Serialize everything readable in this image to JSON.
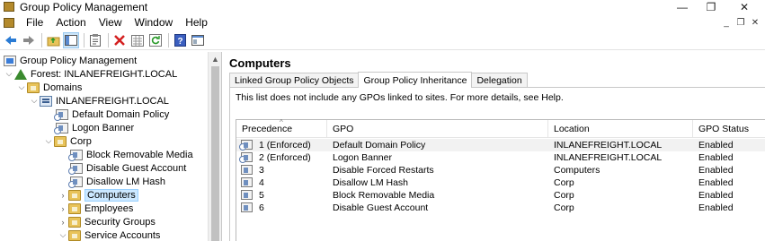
{
  "window": {
    "title": "Group Policy Management",
    "controls": {
      "minimize": "—",
      "maximize": "❐",
      "close": "✕"
    }
  },
  "menu": [
    "File",
    "Action",
    "View",
    "Window",
    "Help"
  ],
  "mdi_controls": {
    "minimize": "_",
    "restore": "❐",
    "close": "✕"
  },
  "toolbar": {
    "icons": [
      "back-arrow-icon",
      "forward-arrow-icon",
      "up-folder-icon",
      "show-tree-icon",
      "properties-icon",
      "delete-icon",
      "export-icon",
      "refresh-icon",
      "help-icon",
      "console-icon"
    ]
  },
  "tree": {
    "items": [
      {
        "label": "Group Policy Management",
        "icon": "gpm",
        "expander": ""
      },
      {
        "label": "Forest: INLANEFREIGHT.LOCAL",
        "icon": "forest",
        "expander": "⌵"
      },
      {
        "label": "Domains",
        "icon": "folder",
        "expander": "⌵"
      },
      {
        "label": "INLANEFREIGHT.LOCAL",
        "icon": "domain",
        "expander": "⌵"
      },
      {
        "label": "Default Domain Policy",
        "icon": "gpo-link",
        "expander": ""
      },
      {
        "label": "Logon Banner",
        "icon": "gpo-link",
        "expander": ""
      },
      {
        "label": "Corp",
        "icon": "folder",
        "expander": "⌵"
      },
      {
        "label": "Block Removable Media",
        "icon": "gpo-link",
        "expander": ""
      },
      {
        "label": "Disable Guest Account",
        "icon": "gpo-link",
        "expander": ""
      },
      {
        "label": "Disallow LM Hash",
        "icon": "gpo-link",
        "expander": ""
      },
      {
        "label": "Computers",
        "icon": "folder",
        "expander": "›",
        "selected": true
      },
      {
        "label": "Employees",
        "icon": "folder",
        "expander": "›"
      },
      {
        "label": "Security Groups",
        "icon": "folder",
        "expander": "›"
      },
      {
        "label": "Service Accounts",
        "icon": "folder",
        "expander": "⌵"
      }
    ]
  },
  "details": {
    "title": "Computers",
    "tabs": [
      "Linked Group Policy Objects",
      "Group Policy Inheritance",
      "Delegation"
    ],
    "active_tab": "Group Policy Inheritance",
    "note": "This list does not include any GPOs linked to sites. For more details, see Help.",
    "columns": [
      "Precedence",
      "GPO",
      "Location",
      "GPO Status"
    ],
    "rows": [
      {
        "precedence": "1 (Enforced)",
        "gpo": "Default Domain Policy",
        "location": "INLANEFREIGHT.LOCAL",
        "status": "Enabled"
      },
      {
        "precedence": "2 (Enforced)",
        "gpo": "Logon Banner",
        "location": "INLANEFREIGHT.LOCAL",
        "status": "Enabled"
      },
      {
        "precedence": "3",
        "gpo": "Disable Forced Restarts",
        "location": "Computers",
        "status": "Enabled"
      },
      {
        "precedence": "4",
        "gpo": "Disallow LM Hash",
        "location": "Corp",
        "status": "Enabled"
      },
      {
        "precedence": "5",
        "gpo": "Block Removable Media",
        "location": "Corp",
        "status": "Enabled"
      },
      {
        "precedence": "6",
        "gpo": "Disable Guest Account",
        "location": "Corp",
        "status": "Enabled"
      }
    ]
  }
}
